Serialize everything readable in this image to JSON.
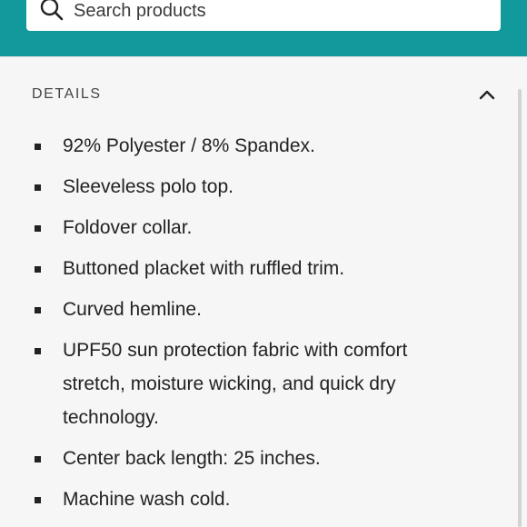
{
  "search": {
    "placeholder": "Search products",
    "icon": "search-icon"
  },
  "header": {
    "background_color": "#12999b"
  },
  "details": {
    "title": "DETAILS",
    "toggle_icon": "chevron-up-icon",
    "expanded": true,
    "items": [
      {
        "text": "92% Polyester / 8% Spandex."
      },
      {
        "text": "Sleeveless polo top."
      },
      {
        "text": "Foldover collar."
      },
      {
        "text": "Buttoned placket with ruffled trim."
      },
      {
        "text": "Curved hemline."
      },
      {
        "text": "UPF50 sun protection fabric with comfort stretch, moisture wicking, and quick dry technology."
      },
      {
        "text": "Center back length: 25 inches."
      },
      {
        "text": "Machine wash cold."
      }
    ]
  }
}
